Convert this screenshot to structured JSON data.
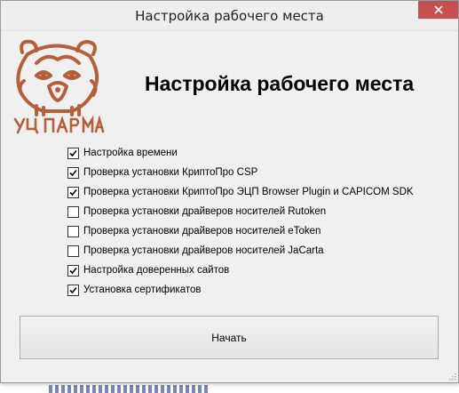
{
  "window": {
    "title": "Настройка рабочего места",
    "close_glyph": "✕"
  },
  "logo": {
    "name": "uc-parma-logo",
    "text": "УЦ ПАРМА",
    "color": "#b5603a"
  },
  "heading": "Настройка рабочего места",
  "checklist": [
    {
      "label": "Настройка времени",
      "checked": true
    },
    {
      "label": "Проверка установки КриптоПро CSP",
      "checked": true
    },
    {
      "label": "Проверка установки КриптоПро ЭЦП Browser Plugin и CAPICOM SDK",
      "checked": true
    },
    {
      "label": "Проверка установки драйверов носителей Rutoken",
      "checked": false
    },
    {
      "label": "Проверка установки драйверов носителей eToken",
      "checked": false
    },
    {
      "label": "Проверка установки драйверов носителей JaCarta",
      "checked": false
    },
    {
      "label": "Настройка доверенных сайтов",
      "checked": true
    },
    {
      "label": "Установка сертификатов",
      "checked": true
    }
  ],
  "start_button": "Начать",
  "colors": {
    "close_button": "#c74f4f",
    "window_bg": "#f0f0f0",
    "brand": "#b5603a"
  }
}
